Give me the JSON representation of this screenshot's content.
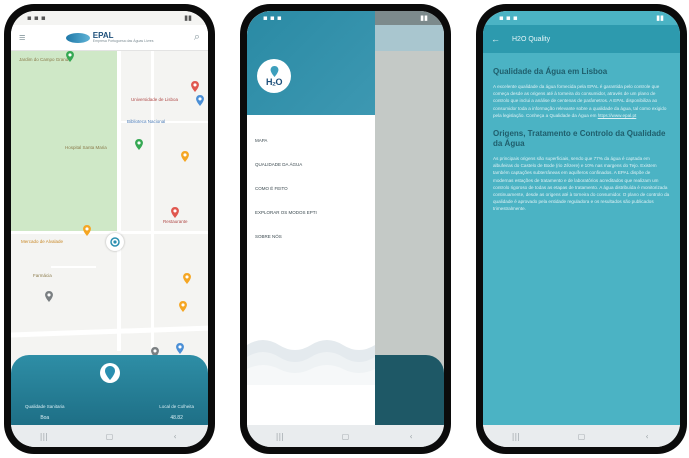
{
  "phone1": {
    "status_right": "",
    "header": {
      "logo_main": "EPAL",
      "logo_sub": "Empresa Portuguesa das Águas Livres"
    },
    "map_labels": [
      "Jardim do Campo Grande",
      "Universidade de Lisboa",
      "Biblioteca Nacional",
      "Hospital Santa Maria",
      "Mercado de Alvalade",
      "Farmácia",
      "Restaurante"
    ],
    "panel": {
      "stat1_label": "Qualidade Sanitaria",
      "stat1_value": "Boa",
      "stat2_label": "Local de Colheita",
      "stat2_value": "48.82"
    },
    "pin_colors": {
      "water": "#4b8fd6",
      "orange": "#f5a623",
      "green": "#35a853",
      "red": "#e0574f",
      "grey": "#7a7f82"
    }
  },
  "phone2": {
    "logo_text": "H₂O",
    "menu": [
      "MAPA",
      "QUALIDADE DA ÁGUA",
      "COMO É FEITO",
      "EXPLORAR OS MODOS EPTI",
      "SOBRE NÓS"
    ]
  },
  "phone3": {
    "title": "H2O Quality",
    "heading1": "Qualidade da Água em Lisboa",
    "para1_a": "A excelente qualidade da água fornecida pela EPAL é garantida pelo controle que começa desde as origens até à torneira do consumidor, através de um plano de controlo que inclui a análise de centenas de parâmetros. A EPAL disponibiliza ao consumidor toda a informação relevante sobre a qualidade da água, tal como exigido pela legislação. Conheça a Qualidade da Água em ",
    "para1_link": "https://www.epal.pt",
    "heading2": "Origens, Tratamento e Controlo da Qualidade da Água",
    "para2": "As principais origens são superficiais, sendo que 77% da água é captada em albufeiras do Castelo de Bode (rio Zêzere) e 10% nas margens do Tejo. Existem também captações subterrâneas em aquíferos confinados. A EPAL dispõe de modernas estações de tratamento e de laboratórios acreditados que realizam um controlo rigoroso de todas as etapas de tratamento. A água distribuída é monitorizada continuamente, desde as origens até à torneira do consumidor. O plano de controlo da qualidade é aprovado pela entidade reguladora e os resultados são publicados trimestralmente."
  },
  "nav": {
    "recent": "|||",
    "home": "▢",
    "back": "‹"
  }
}
